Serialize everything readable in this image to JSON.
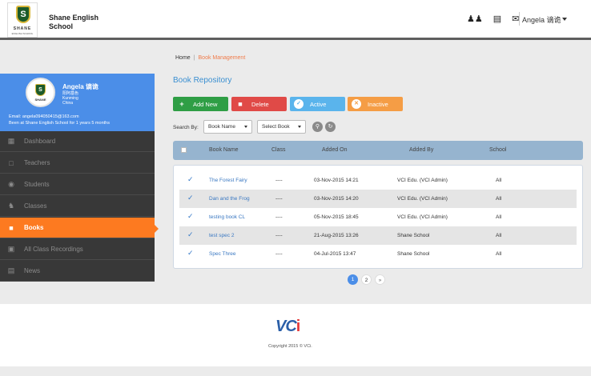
{
  "header": {
    "logo_text": "SHANE",
    "logo_sub": "ENGLISH SCHOOL",
    "logo_mark": "S",
    "school_name": "Shane English School",
    "user_name": "Angela 谪诡",
    "icons": [
      "group-icon",
      "book-open-icon",
      "envelope-icon"
    ]
  },
  "breadcrumb": {
    "home": "Home",
    "current": "Book Management"
  },
  "profile": {
    "name": "Angela 谪诡",
    "cn_name": "阳阿基色",
    "city": "Kunming",
    "country": "China",
    "email_label": "Email:",
    "email": "angela094050415@163.com",
    "since": "Been at Shane English School for 1 years 5 months"
  },
  "sidebar": {
    "items": [
      {
        "label": "Dashboard",
        "icon": "grid-icon"
      },
      {
        "label": "Teachers",
        "icon": "teacher-icon"
      },
      {
        "label": "Students",
        "icon": "students-icon"
      },
      {
        "label": "Classes",
        "icon": "classes-icon"
      },
      {
        "label": "Books",
        "icon": "books-icon"
      },
      {
        "label": "All Class Recordings",
        "icon": "recordings-icon"
      },
      {
        "label": "News",
        "icon": "news-icon"
      }
    ],
    "active": "Books"
  },
  "main": {
    "title": "Book Repository",
    "buttons": {
      "add": "Add New",
      "delete": "Delete",
      "active": "Active",
      "inactive": "Inactive"
    },
    "search": {
      "label": "Search By:",
      "field_select": "Book Name",
      "book_select": "Select Book"
    },
    "table": {
      "headers": [
        "Book Name",
        "Class",
        "Added On",
        "Added By",
        "School"
      ],
      "rows": [
        {
          "book": "The Forest Fairy",
          "class": "----",
          "added_on": "03-Nov-2015 14:21",
          "added_by": "VCI Edu. (VCI Admin)",
          "school": "All"
        },
        {
          "book": "Dan and the Frog",
          "class": "----",
          "added_on": "03-Nov-2015 14:20",
          "added_by": "VCI Edu. (VCI Admin)",
          "school": "All"
        },
        {
          "book": "testing book CL",
          "class": "----",
          "added_on": "05-Nov-2015 18:45",
          "added_by": "VCI Edu. (VCI Admin)",
          "school": "All"
        },
        {
          "book": "test spec 2",
          "class": "----",
          "added_on": "21-Aug-2015 13:26",
          "added_by": "Shane School",
          "school": "All"
        },
        {
          "book": "Spec Three",
          "class": "----",
          "added_on": "04-Jul-2015 13:47",
          "added_by": "Shane School",
          "school": "All"
        }
      ]
    },
    "pagination": {
      "pages": [
        "1",
        "2"
      ],
      "next": "»",
      "current": "1"
    }
  },
  "footer": {
    "logo": "VC",
    "logo_accent": "i",
    "copyright": "Copyright 2015 © VCi."
  },
  "colors": {
    "accent": "#4b8ee8",
    "active_nav": "#fd7a20",
    "add": "#2f9e45",
    "delete": "#e04a47",
    "activate": "#5ab4ec",
    "inactivate": "#f59d45"
  }
}
